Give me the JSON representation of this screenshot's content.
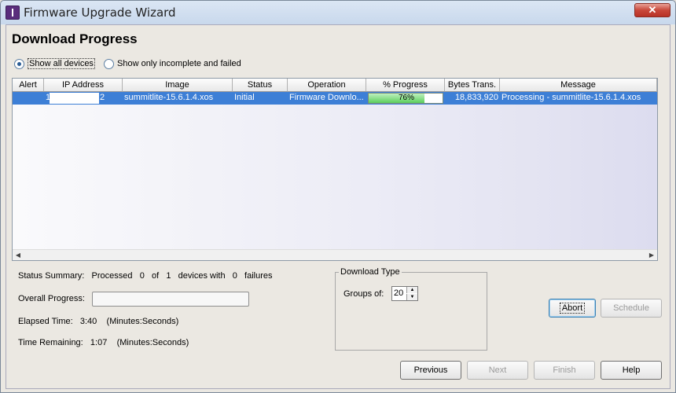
{
  "window": {
    "title": "Firmware Upgrade Wizard",
    "close_glyph": "✕"
  },
  "page": {
    "heading": "Download Progress"
  },
  "filter": {
    "options": [
      {
        "label": "Show all devices",
        "selected": true
      },
      {
        "label": "Show only incomplete and failed",
        "selected": false
      }
    ]
  },
  "table": {
    "columns": [
      "Alert",
      "IP Address",
      "Image",
      "Status",
      "Operation",
      "% Progress",
      "Bytes Trans.",
      "Message"
    ],
    "rows": [
      {
        "alert": "",
        "ip_prefix": "1",
        "ip_suffix": "2",
        "image": "summitlite-15.6.1.4.xos",
        "status": "Initial",
        "operation": "Firmware Downlo...",
        "progress_label": "76%",
        "progress_value": 76,
        "bytes": "18,833,920",
        "message": "Processing - summitlite-15.6.1.4.xos"
      }
    ]
  },
  "summary": {
    "status_label": "Status Summary:",
    "processed_label": "Processed",
    "processed": "0",
    "of_label": "of",
    "total": "1",
    "devices_with_label": "devices with",
    "failures": "0",
    "failures_label": "failures",
    "overall_progress_label": "Overall Progress:",
    "overall_progress_value": 0,
    "elapsed_label": "Elapsed Time:",
    "elapsed": "3:40",
    "elapsed_unit": "(Minutes:Seconds)",
    "remaining_label": "Time Remaining:",
    "remaining": "1:07",
    "remaining_unit": "(Minutes:Seconds)"
  },
  "download_type": {
    "title": "Download Type",
    "groups_label": "Groups of:",
    "groups_value": "20"
  },
  "buttons": {
    "abort": "Abort",
    "schedule": "Schedule",
    "previous": "Previous",
    "next": "Next",
    "finish": "Finish",
    "help": "Help"
  }
}
